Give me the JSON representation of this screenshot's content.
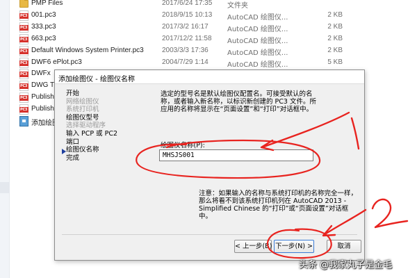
{
  "file_list": [
    {
      "name": "PMP Files",
      "date": "2017/6/24 17:35",
      "type": "文件夹",
      "size": "",
      "icon": "folder-icon"
    },
    {
      "name": "001.pc3",
      "date": "2018/9/15 10:13",
      "type": "AutoCAD 绘图仪...",
      "size": "2 KB",
      "icon": "pc3-file-icon"
    },
    {
      "name": "333.pc3",
      "date": "2017/3/2 16:17",
      "type": "AutoCAD 绘图仪...",
      "size": "2 KB",
      "icon": "pc3-file-icon"
    },
    {
      "name": "663.pc3",
      "date": "2017/12/2 11:58",
      "type": "AutoCAD 绘图仪...",
      "size": "2 KB",
      "icon": "pc3-file-icon"
    },
    {
      "name": "Default Windows System Printer.pc3",
      "date": "2003/3/3 17:36",
      "type": "AutoCAD 绘图仪...",
      "size": "2 KB",
      "icon": "pc3-file-icon"
    },
    {
      "name": "DWF6 ePlot.pc3",
      "date": "2004/7/29 1:14",
      "type": "AutoCAD 绘图仪...",
      "size": "5 KB",
      "icon": "pc3-file-icon"
    },
    {
      "name": "DWFx",
      "date": "",
      "type": "",
      "size": "",
      "icon": "pc3-file-icon"
    },
    {
      "name": "DWG T",
      "date": "",
      "type": "",
      "size": "",
      "icon": "pc3-file-icon"
    },
    {
      "name": "Publish",
      "date": "",
      "type": "",
      "size": "",
      "icon": "pc3-file-icon"
    },
    {
      "name": "Publish",
      "date": "",
      "type": "",
      "size": "",
      "icon": "pc3-file-icon"
    },
    {
      "name": "添加绘图",
      "date": "",
      "type": "",
      "size": "",
      "icon": "add-plotter-wizard-icon"
    }
  ],
  "dialog": {
    "title": "添加绘图仪 - 绘图仪名称",
    "steps": [
      {
        "label": "开始",
        "state": "normal"
      },
      {
        "label": "网络绘图仪",
        "state": "disabled"
      },
      {
        "label": "系统打印机",
        "state": "disabled"
      },
      {
        "label": "绘图仪型号",
        "state": "normal"
      },
      {
        "label": "选择驱动程序",
        "state": "disabled"
      },
      {
        "label": "输入 PCP 或 PC2",
        "state": "normal"
      },
      {
        "label": "端口",
        "state": "normal"
      },
      {
        "label": "绘图仪名称",
        "state": "current"
      },
      {
        "label": "完成",
        "state": "normal"
      }
    ],
    "description": "选定的型号名是默认绘图仪配置名。可接受默认的名称，或者输入新名称，以标识新创建的 PC3 文件。所应用的名称将显示在“页面设置”和“打印”对话框中。",
    "name_label": "绘图仪名称(P):",
    "name_value": "MHSJS001",
    "note": "注意：如果输入的名称与系统打印机的名称完全一样，那么将看不到该系统打印机列在 AutoCAD 2013 - Simplified Chinese 的“打印”或“页面设置”对话框中。",
    "buttons": {
      "back": "< 上一步(B)",
      "next": "下一步(N) >",
      "cancel": "取消"
    }
  },
  "annotations": {
    "color": "#e8231f",
    "number_1": "1",
    "number_2": "2"
  },
  "watermark": "头条 @我家丸子是金毛"
}
